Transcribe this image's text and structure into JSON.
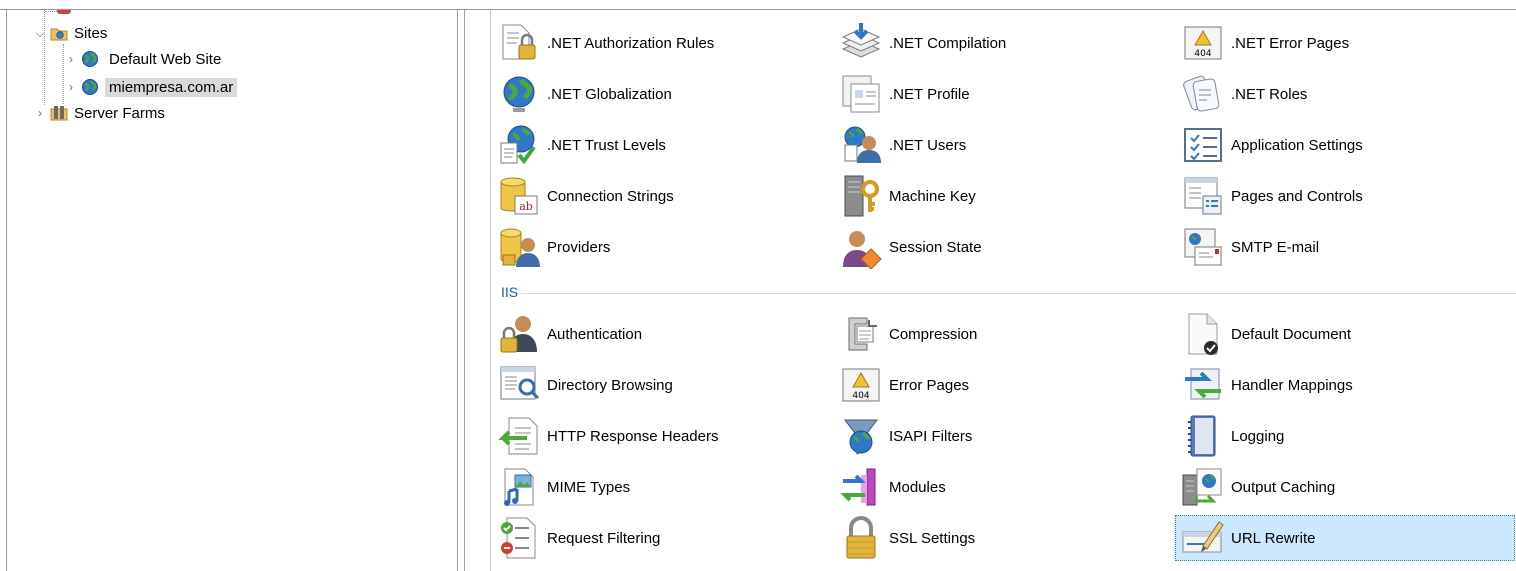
{
  "tree": {
    "items": [
      {
        "label": "Sites",
        "expander": "open",
        "icon": "sites-folder-icon"
      },
      {
        "label": "Default Web Site",
        "expander": "closed",
        "icon": "globe-icon"
      },
      {
        "label": "miempresa.com.ar",
        "expander": "closed",
        "icon": "globe-icon",
        "selected": true
      },
      {
        "label": "Server Farms",
        "expander": "closed",
        "icon": "server-farms-icon"
      }
    ]
  },
  "features": {
    "aspnet": [
      [
        ".NET Authorization Rules",
        ".NET Compilation",
        ".NET Error Pages"
      ],
      [
        ".NET Globalization",
        ".NET Profile",
        ".NET Roles"
      ],
      [
        ".NET Trust Levels",
        ".NET Users",
        "Application Settings"
      ],
      [
        "Connection Strings",
        "Machine Key",
        "Pages and Controls"
      ],
      [
        "Providers",
        "Session State",
        "SMTP E-mail"
      ]
    ],
    "iis_group_label": "IIS",
    "iis": [
      [
        "Authentication",
        "Compression",
        "Default Document"
      ],
      [
        "Directory Browsing",
        "Error Pages",
        "Handler Mappings"
      ],
      [
        "HTTP Response Headers",
        "ISAPI Filters",
        "Logging"
      ],
      [
        "MIME Types",
        "Modules",
        "Output Caching"
      ],
      [
        "Request Filtering",
        "SSL Settings",
        "URL Rewrite"
      ]
    ],
    "selected": "URL Rewrite"
  },
  "colors": {
    "selection_bg": "#cce8ff",
    "group_label": "#1a5ea8",
    "tree_selection_bg": "#d9d9d9"
  }
}
